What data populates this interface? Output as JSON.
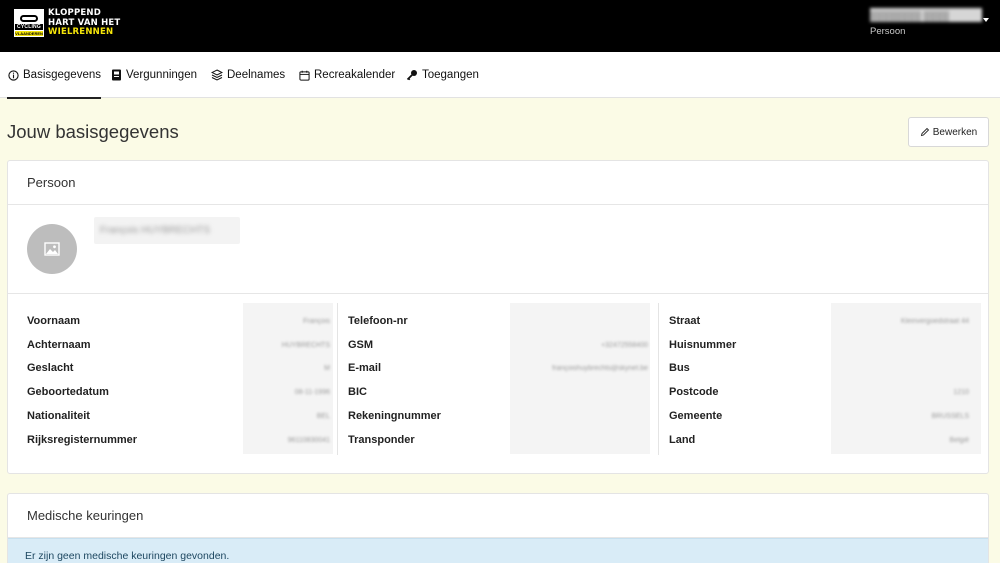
{
  "brand": {
    "line1": "KLOPPEND",
    "line2": "HART VAN HET",
    "line3": "WIELRENNEN",
    "badge_top": "CYCLING",
    "badge_bottom": "VLAANDEREN"
  },
  "user": {
    "name": "████████ ████",
    "role": "Persoon"
  },
  "tabs": [
    {
      "label": "Basisgegevens",
      "icon": "info-circle-icon",
      "active": true
    },
    {
      "label": "Vergunningen",
      "icon": "license-card-icon",
      "active": false
    },
    {
      "label": "Deelnames",
      "icon": "layers-icon",
      "active": false
    },
    {
      "label": "Recreakalender",
      "icon": "calendar-icon",
      "active": false
    },
    {
      "label": "Toegangen",
      "icon": "key-icon",
      "active": false
    }
  ],
  "page": {
    "title": "Jouw basisgegevens",
    "edit_label": "Bewerken"
  },
  "person": {
    "header": "Persoon",
    "full_name": "François HUYBRECHTS",
    "col1": [
      {
        "label": "Voornaam",
        "value": "François"
      },
      {
        "label": "Achternaam",
        "value": "HUYBRECHTS"
      },
      {
        "label": "Geslacht",
        "value": "M"
      },
      {
        "label": "Geboortedatum",
        "value": "08-11-1996"
      },
      {
        "label": "Nationaliteit",
        "value": "BEL"
      },
      {
        "label": "Rijksregisternummer",
        "value": "96110830041"
      }
    ],
    "col2": [
      {
        "label": "Telefoon-nr",
        "value": ""
      },
      {
        "label": "GSM",
        "value": "+32472558400"
      },
      {
        "label": "E-mail",
        "value": "françoishuybrechts@skynet.be"
      },
      {
        "label": "BIC",
        "value": ""
      },
      {
        "label": "Rekeningnummer",
        "value": ""
      },
      {
        "label": "Transponder",
        "value": ""
      }
    ],
    "col3": [
      {
        "label": "Straat",
        "value": "Kleinvergoedstraat 44"
      },
      {
        "label": "Huisnummer",
        "value": ""
      },
      {
        "label": "Bus",
        "value": ""
      },
      {
        "label": "Postcode",
        "value": "1210"
      },
      {
        "label": "Gemeente",
        "value": "BRUSSELS"
      },
      {
        "label": "Land",
        "value": "België"
      }
    ]
  },
  "medical": {
    "header": "Medische keuringen",
    "empty_message": "Er zijn geen medische keuringen gevonden."
  },
  "colors": {
    "topbar": "#000000",
    "brand_yellow": "#f5e50a",
    "page_bg": "#fbfbe6",
    "info_bg": "#d9ecf7"
  }
}
